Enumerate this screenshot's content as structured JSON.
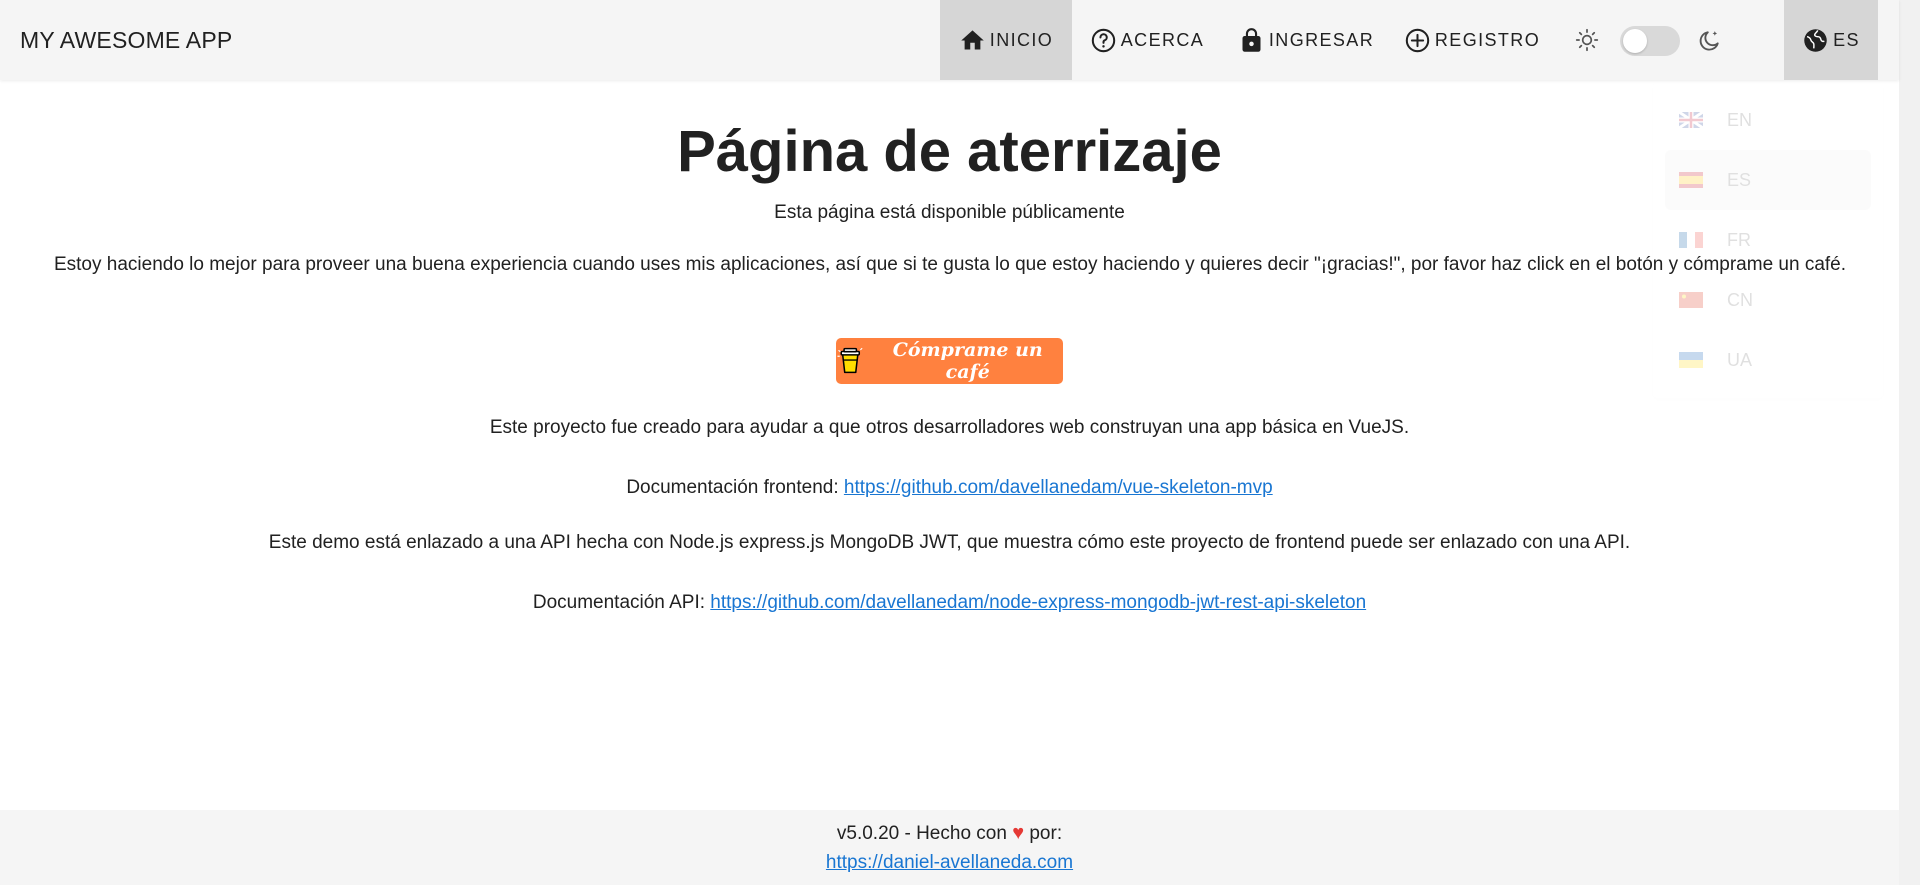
{
  "app": {
    "title": "MY AWESOME APP"
  },
  "nav": {
    "home_label": "INICIO",
    "about_label": "ACERCA",
    "login_label": "INGRESAR",
    "signup_label": "REGISTRO",
    "language_label": "ES"
  },
  "language_menu": {
    "items": [
      {
        "code": "EN",
        "flag": "gb-flag-icon"
      },
      {
        "code": "ES",
        "flag": "es-flag-icon",
        "selected": true
      },
      {
        "code": "FR",
        "flag": "fr-flag-icon"
      },
      {
        "code": "CN",
        "flag": "cn-flag-icon"
      },
      {
        "code": "UA",
        "flag": "ua-flag-icon"
      }
    ]
  },
  "theme": {
    "dark_mode_enabled": false
  },
  "main": {
    "title": "Página de aterrizaje",
    "subtitle": "Esta página está disponible públicamente",
    "intro": "Estoy haciendo lo mejor para proveer una buena experiencia cuando uses mis aplicaciones, así que si te gusta lo que estoy haciendo y quieres decir \"¡gracias!\", por favor haz click en el botón y cómprame un café.",
    "coffee_button_label": "Cómprame un café",
    "project_text": "Este proyecto fue creado para ayudar a que otros desarrolladores web construyan una app básica en VueJS.",
    "frontend_docs_label": "Documentación frontend: ",
    "frontend_docs_url": "https://github.com/davellanedam/vue-skeleton-mvp",
    "api_text": "Este demo está enlazado a una API hecha con Node.js express.js MongoDB JWT, que muestra cómo este proyecto de frontend puede ser enlazado con una API.",
    "api_docs_label": "Documentación API: ",
    "api_docs_url": "https://github.com/davellanedam/node-express-mongodb-jwt-rest-api-skeleton"
  },
  "footer": {
    "version_text": "v5.0.20 - Hecho con",
    "heart": "♥",
    "by_text": "por:",
    "author_url": "https://daniel-avellaneda.com"
  },
  "colors": {
    "appbar_bg": "#f5f5f5",
    "active_nav_bg": "#d6d6d6",
    "link": "#1976d2",
    "coffee_button": "#ff813f",
    "heart": "#e53935"
  }
}
